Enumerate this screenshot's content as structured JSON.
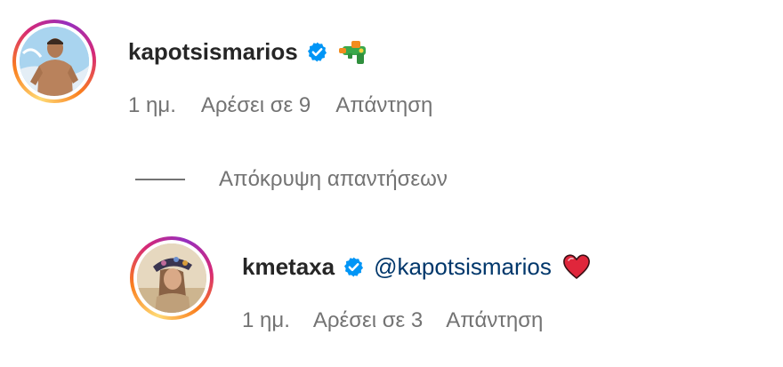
{
  "comment1": {
    "username": "kapotsismarios",
    "emoji_icon": "water-gun-icon",
    "time": "1 ημ.",
    "likes": "Αρέσει σε 9",
    "reply": "Απάντηση"
  },
  "hide_replies": {
    "label": "Απόκρυψη απαντήσεων"
  },
  "comment2": {
    "username": "kmetaxa",
    "mention": "@kapotsismarios",
    "emoji_icon": "red-heart-icon",
    "time": "1 ημ.",
    "likes": "Αρέσει σε 3",
    "reply": "Απάντηση"
  },
  "colors": {
    "text": "#262626",
    "secondary": "#737373",
    "mention": "#00376b",
    "verified": "#0095f6"
  }
}
